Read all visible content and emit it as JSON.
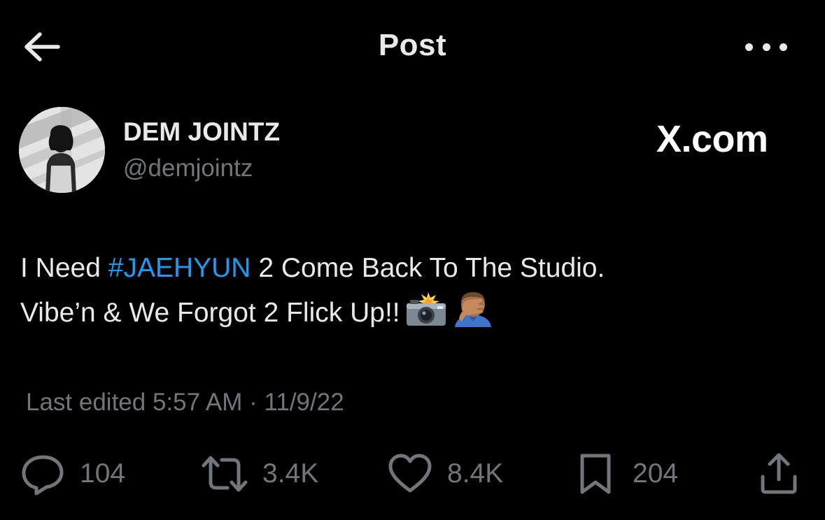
{
  "header": {
    "title": "Post",
    "back_icon": "arrow-left-icon",
    "more_icon": "more-horizontal-icon"
  },
  "author": {
    "display_name": "DEM JOINTZ",
    "handle": "@demjointz",
    "avatar_icon": "avatar-photo"
  },
  "watermark": "X.com",
  "post": {
    "text_before": "I Need ",
    "hashtag": "#JAEHYUN",
    "text_after_line1": " 2 Come Back To The Studio.",
    "line2": "Vibe’n & We Forgot 2 Flick Up!!",
    "emoji_1": "camera-with-flash-emoji",
    "emoji_2": "face-palm-emoji"
  },
  "meta": {
    "text": "Last edited 5:57 AM · 11/9/22"
  },
  "actions": {
    "replies": "104",
    "reposts": "3.4K",
    "likes": "8.4K",
    "bookmarks": "204"
  },
  "colors": {
    "background": "#000000",
    "primary_text": "#e7e9ea",
    "secondary_text": "#71767b",
    "link": "#1d9bf0"
  }
}
